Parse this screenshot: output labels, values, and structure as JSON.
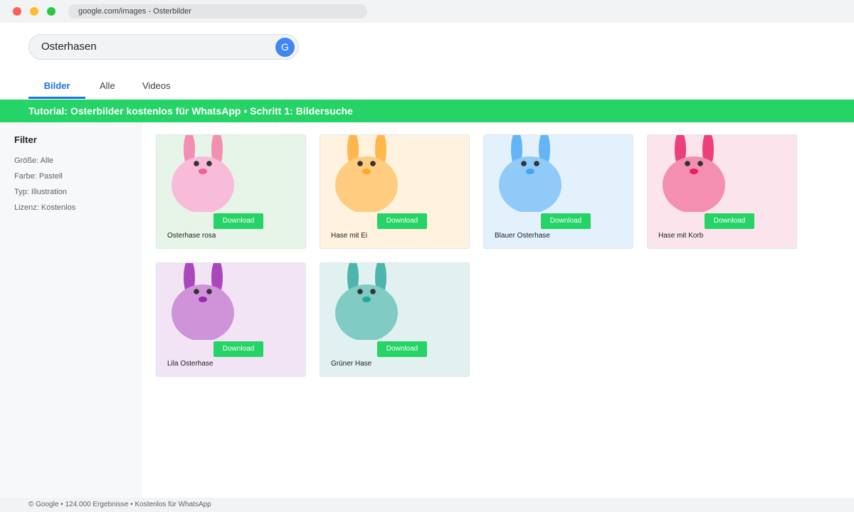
{
  "browser": {
    "url": "google.com/images - Osterbilder"
  },
  "search": {
    "query": "Osterhasen",
    "button_label": "G"
  },
  "tabs": [
    {
      "label": "Bilder"
    },
    {
      "label": "Alle"
    },
    {
      "label": "Videos"
    }
  ],
  "banner": "Tutorial: Osterbilder kostenlos für WhatsApp • Schritt 1: Bildersuche",
  "sidebar": {
    "title": "Filter",
    "items": [
      {
        "label": "Größe: Alle"
      },
      {
        "label": "Farbe: Pastell"
      },
      {
        "label": "Typ: Illustration"
      },
      {
        "label": "Lizenz: Kostenlos"
      }
    ]
  },
  "results": [
    {
      "caption": "Osterhase rosa",
      "button": "Download",
      "bg": "#e7f4e8",
      "body": "#f8bbd9",
      "ear": "#f48fb1",
      "nose": "#f06292",
      "icon": "bunny-icon"
    },
    {
      "caption": "Hase mit Ei",
      "button": "Download",
      "bg": "#fff2df",
      "body": "#ffcc80",
      "ear": "#ffb74d",
      "nose": "#ffa726",
      "icon": "bunny-icon"
    },
    {
      "caption": "Blauer Osterhase",
      "button": "Download",
      "bg": "#e3f1fc",
      "body": "#90caf9",
      "ear": "#64b5f6",
      "nose": "#42a5f5",
      "icon": "bunny-icon"
    },
    {
      "caption": "Hase mit Korb",
      "button": "Download",
      "bg": "#fbe4ec",
      "body": "#f48fb1",
      "ear": "#ec407a",
      "nose": "#e91e63",
      "icon": "bunny-icon"
    },
    {
      "caption": "Lila Osterhase",
      "button": "Download",
      "bg": "#f2e4f5",
      "body": "#ce93d8",
      "ear": "#ab47bc",
      "nose": "#9c27b0",
      "icon": "bunny-icon"
    },
    {
      "caption": "Grüner Hase",
      "button": "Download",
      "bg": "#e0f1f0",
      "body": "#80cbc4",
      "ear": "#4db6ac",
      "nose": "#26a69a",
      "icon": "bunny-icon"
    }
  ],
  "footer": "© Google • 124.000 Ergebnisse • Kostenlos für WhatsApp",
  "colors": {
    "accent": "#1a73e8",
    "whatsapp_green": "#25d366"
  }
}
